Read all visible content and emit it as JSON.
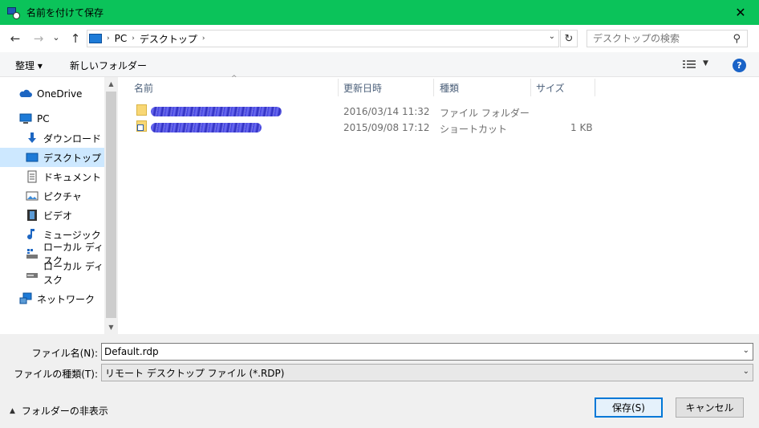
{
  "titlebar": {
    "title": "名前を付けて保存",
    "close_glyph": "✕"
  },
  "nav": {
    "back_glyph": "←",
    "forward_glyph": "→",
    "recent_glyph": "⌄",
    "up_glyph": "↑",
    "address": {
      "segments": [
        "PC",
        "デスクトップ"
      ],
      "separator": "›"
    },
    "refresh_glyph": "↻",
    "search_placeholder": "デスクトップの検索",
    "search_glyph": "⚲"
  },
  "cmdbar": {
    "organize_label": "整理 ▾",
    "new_folder_label": "新しいフォルダー",
    "help_label": "?"
  },
  "navpane": {
    "items": [
      {
        "label": "OneDrive",
        "icon": "cloud-icon"
      },
      {
        "label": "PC",
        "icon": "computer-icon"
      },
      {
        "label": "ダウンロード",
        "icon": "download-icon"
      },
      {
        "label": "デスクトップ",
        "icon": "desktop-icon",
        "selected": true
      },
      {
        "label": "ドキュメント",
        "icon": "document-icon"
      },
      {
        "label": "ピクチャ",
        "icon": "pictures-icon"
      },
      {
        "label": "ビデオ",
        "icon": "video-icon"
      },
      {
        "label": "ミュージック",
        "icon": "music-icon"
      },
      {
        "label": "ローカル ディスク",
        "icon": "disk-icon"
      },
      {
        "label": "ローカル ディスク",
        "icon": "disk-icon"
      },
      {
        "label": "ネットワーク",
        "icon": "network-icon"
      }
    ]
  },
  "filelist": {
    "columns": [
      "名前",
      "更新日時",
      "種類",
      "サイズ"
    ],
    "sort_glyph": "^",
    "rows": [
      {
        "date": "2016/03/14 11:32",
        "type": "ファイル フォルダー",
        "size": "",
        "icon": "folder-icon"
      },
      {
        "date": "2015/09/08 17:12",
        "type": "ショートカット",
        "size": "1 KB",
        "icon": "shortcut-icon"
      }
    ]
  },
  "bottom": {
    "filename_label": "ファイル名(N):",
    "filename_value": "Default.rdp",
    "filetype_label": "ファイルの種類(T):",
    "filetype_value": "リモート デスクトップ ファイル (*.RDP)",
    "toggle_folders_label": "フォルダーの非表示",
    "save_label": "保存(S)",
    "cancel_label": "キャンセル"
  }
}
